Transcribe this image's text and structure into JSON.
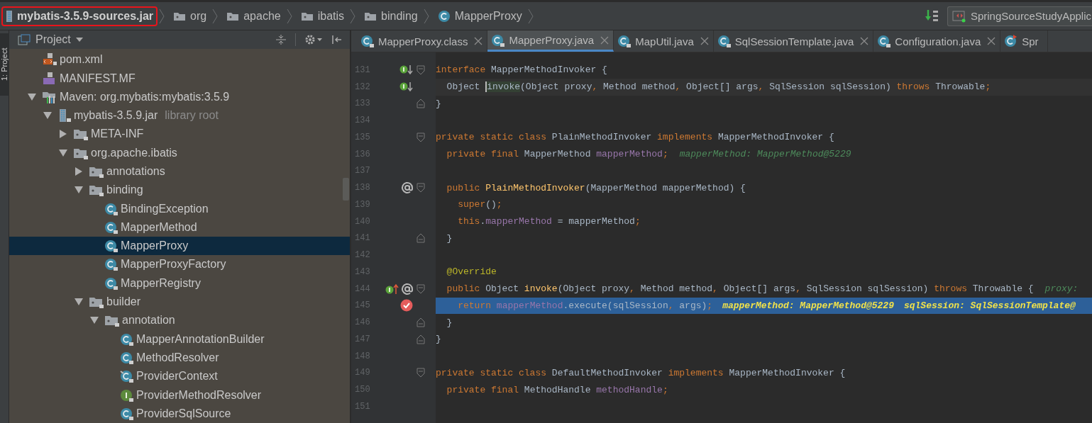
{
  "breadcrumbs": [
    {
      "label": "mybatis-3.5.9-sources.jar",
      "kind": "jar",
      "highlighted": true
    },
    {
      "label": "org",
      "kind": "folder",
      "highlighted": false
    },
    {
      "label": "apache",
      "kind": "folder",
      "highlighted": false
    },
    {
      "label": "ibatis",
      "kind": "folder",
      "highlighted": false
    },
    {
      "label": "binding",
      "kind": "folder",
      "highlighted": false
    },
    {
      "label": "MapperProxy",
      "kind": "class",
      "highlighted": false
    }
  ],
  "run_config": {
    "label": "SpringSourceStudyApplic"
  },
  "side_stripe": {
    "label": "1: Project"
  },
  "project_panel": {
    "title": "Project"
  },
  "tree": [
    {
      "label": "pom.xml",
      "kind": "xml",
      "selected": false
    },
    {
      "label": "MANIFEST.MF",
      "kind": "manifest",
      "selected": false
    },
    {
      "label": "Maven: org.mybatis:mybatis:3.5.9",
      "kind": "maven",
      "expanded": true,
      "selected": false,
      "children": [
        {
          "label": "mybatis-3.5.9.jar",
          "note": "library root",
          "kind": "jar",
          "expanded": true,
          "selected": false,
          "children": [
            {
              "label": "META-INF",
              "kind": "folder",
              "expanded": false,
              "selected": false
            },
            {
              "label": "org.apache.ibatis",
              "kind": "folder",
              "expanded": true,
              "selected": false,
              "children": [
                {
                  "label": "annotations",
                  "kind": "folder",
                  "expanded": false,
                  "selected": false
                },
                {
                  "label": "binding",
                  "kind": "folder",
                  "expanded": true,
                  "selected": false,
                  "children": [
                    {
                      "label": "BindingException",
                      "kind": "class",
                      "selected": false
                    },
                    {
                      "label": "MapperMethod",
                      "kind": "class",
                      "selected": false
                    },
                    {
                      "label": "MapperProxy",
                      "kind": "class",
                      "selected": true
                    },
                    {
                      "label": "MapperProxyFactory",
                      "kind": "class",
                      "selected": false
                    },
                    {
                      "label": "MapperRegistry",
                      "kind": "class",
                      "selected": false
                    }
                  ]
                },
                {
                  "label": "builder",
                  "kind": "folder",
                  "expanded": true,
                  "selected": false,
                  "children": [
                    {
                      "label": "annotation",
                      "kind": "folder",
                      "expanded": true,
                      "selected": false,
                      "children": [
                        {
                          "label": "MapperAnnotationBuilder",
                          "kind": "class",
                          "selected": false
                        },
                        {
                          "label": "MethodResolver",
                          "kind": "class",
                          "selected": false
                        },
                        {
                          "label": "ProviderContext",
                          "kind": "annotated-class",
                          "selected": false
                        },
                        {
                          "label": "ProviderMethodResolver",
                          "kind": "interface",
                          "selected": false
                        },
                        {
                          "label": "ProviderSqlSource",
                          "kind": "class",
                          "selected": false
                        }
                      ]
                    }
                  ]
                }
              ]
            }
          ]
        }
      ]
    }
  ],
  "tabs": [
    {
      "label": "MapperProxy.class",
      "kind": "class",
      "selected": false
    },
    {
      "label": "MapperProxy.java",
      "kind": "class",
      "selected": true
    },
    {
      "label": "MapUtil.java",
      "kind": "class",
      "selected": false
    },
    {
      "label": "SqlSessionTemplate.java",
      "kind": "class",
      "selected": false
    },
    {
      "label": "Configuration.java",
      "kind": "class",
      "selected": false
    },
    {
      "label": "Spr",
      "kind": "runnable",
      "selected": false
    }
  ],
  "editor": {
    "lines": [
      {
        "number": "131",
        "markers": [
          {
            "kind": "implemented"
          }
        ],
        "fold": {
          "kind": "open"
        },
        "tokens": [
          {
            "kind": "kw",
            "text": "interface "
          },
          {
            "kind": "plain",
            "text": "MapperMethodInvoker {"
          }
        ]
      },
      {
        "number": "132",
        "markers": [
          {
            "kind": "implemented"
          }
        ],
        "highlight": {
          "kind": "caret"
        },
        "tokens": [
          {
            "kind": "plain",
            "text": "  Object "
          },
          {
            "kind": "usage",
            "text": "invoke"
          },
          {
            "kind": "plain",
            "text": "(Object proxy"
          },
          {
            "kind": "punct",
            "text": ", "
          },
          {
            "kind": "plain",
            "text": "Method method"
          },
          {
            "kind": "punct",
            "text": ", "
          },
          {
            "kind": "plain",
            "text": "Object[] args"
          },
          {
            "kind": "punct",
            "text": ", "
          },
          {
            "kind": "plain",
            "text": "SqlSession sqlSession) "
          },
          {
            "kind": "kw",
            "text": "throws "
          },
          {
            "kind": "plain",
            "text": "Throwable"
          },
          {
            "kind": "punct",
            "text": ";"
          }
        ]
      },
      {
        "number": "133",
        "fold": {
          "kind": "close"
        },
        "tokens": [
          {
            "kind": "plain",
            "text": "}"
          }
        ]
      },
      {
        "number": "134"
      },
      {
        "number": "135",
        "fold": {
          "kind": "open"
        },
        "tokens": [
          {
            "kind": "kw",
            "text": "private static class "
          },
          {
            "kind": "plain",
            "text": "PlainMethodInvoker "
          },
          {
            "kind": "kw",
            "text": "implements "
          },
          {
            "kind": "plain",
            "text": "MapperMethodInvoker {"
          }
        ]
      },
      {
        "number": "136",
        "tokens": [
          {
            "kind": "kw",
            "text": "  private final "
          },
          {
            "kind": "plain",
            "text": "MapperMethod "
          },
          {
            "kind": "field",
            "text": "mapperMethod"
          },
          {
            "kind": "punct",
            "text": ";"
          }
        ],
        "hints": [
          "mapperMethod: MapperMethod@5229"
        ]
      },
      {
        "number": "137"
      },
      {
        "number": "138",
        "markers": [
          {
            "kind": "override"
          }
        ],
        "fold": {
          "kind": "open"
        },
        "tokens": [
          {
            "kind": "kw",
            "text": "  public "
          },
          {
            "kind": "method",
            "text": "PlainMethodInvoker"
          },
          {
            "kind": "plain",
            "text": "(MapperMethod mapperMethod) {"
          }
        ]
      },
      {
        "number": "139",
        "tokens": [
          {
            "kind": "kw",
            "text": "    super"
          },
          {
            "kind": "plain",
            "text": "()"
          },
          {
            "kind": "punct",
            "text": ";"
          }
        ]
      },
      {
        "number": "140",
        "tokens": [
          {
            "kind": "kw",
            "text": "    this"
          },
          {
            "kind": "plain",
            "text": "."
          },
          {
            "kind": "field",
            "text": "mapperMethod"
          },
          {
            "kind": "plain",
            "text": " = mapperMethod"
          },
          {
            "kind": "punct",
            "text": ";"
          }
        ]
      },
      {
        "number": "141",
        "fold": {
          "kind": "close"
        },
        "tokens": [
          {
            "kind": "plain",
            "text": "  }"
          }
        ]
      },
      {
        "number": "142"
      },
      {
        "number": "143",
        "tokens": [
          {
            "kind": "annot",
            "text": "  @Override"
          }
        ]
      },
      {
        "number": "144",
        "markers": [
          {
            "kind": "implementing"
          },
          {
            "kind": "override"
          }
        ],
        "fold": {
          "kind": "open"
        },
        "tokens": [
          {
            "kind": "kw",
            "text": "  public "
          },
          {
            "kind": "plain",
            "text": "Object "
          },
          {
            "kind": "method",
            "text": "invoke"
          },
          {
            "kind": "plain",
            "text": "(Object proxy"
          },
          {
            "kind": "punct",
            "text": ", "
          },
          {
            "kind": "plain",
            "text": "Method method"
          },
          {
            "kind": "punct",
            "text": ", "
          },
          {
            "kind": "plain",
            "text": "Object[] args"
          },
          {
            "kind": "punct",
            "text": ", "
          },
          {
            "kind": "plain",
            "text": "SqlSession sqlSession) "
          },
          {
            "kind": "kw",
            "text": "throws "
          },
          {
            "kind": "plain",
            "text": "Throwable {"
          }
        ],
        "hints": [
          "proxy:"
        ]
      },
      {
        "number": "145",
        "markers": [
          {
            "kind": "breakpoint"
          }
        ],
        "highlight": {
          "kind": "execution"
        },
        "tokens": [
          {
            "kind": "kw",
            "text": "    return "
          },
          {
            "kind": "field",
            "text": "mapperMethod"
          },
          {
            "kind": "plain",
            "text": ".execute(sqlSession"
          },
          {
            "kind": "punct",
            "text": ", "
          },
          {
            "kind": "plain",
            "text": "args)"
          },
          {
            "kind": "punct",
            "text": ";"
          }
        ],
        "hints": [
          "mapperMethod: MapperMethod@5229",
          "sqlSession: SqlSessionTemplate@"
        ]
      },
      {
        "number": "146",
        "fold": {
          "kind": "close"
        },
        "tokens": [
          {
            "kind": "plain",
            "text": "  }"
          }
        ]
      },
      {
        "number": "147",
        "fold": {
          "kind": "close"
        },
        "tokens": [
          {
            "kind": "plain",
            "text": "}"
          }
        ]
      },
      {
        "number": "148"
      },
      {
        "number": "149",
        "fold": {
          "kind": "open"
        },
        "tokens": [
          {
            "kind": "kw",
            "text": "private static class "
          },
          {
            "kind": "plain",
            "text": "DefaultMethodInvoker "
          },
          {
            "kind": "kw",
            "text": "implements "
          },
          {
            "kind": "plain",
            "text": "MapperMethodInvoker {"
          }
        ]
      },
      {
        "number": "150",
        "tokens": [
          {
            "kind": "kw",
            "text": "  private final "
          },
          {
            "kind": "plain",
            "text": "MethodHandle "
          },
          {
            "kind": "field",
            "text": "methodHandle"
          },
          {
            "kind": "punct",
            "text": ";"
          }
        ]
      },
      {
        "number": "151"
      }
    ]
  }
}
